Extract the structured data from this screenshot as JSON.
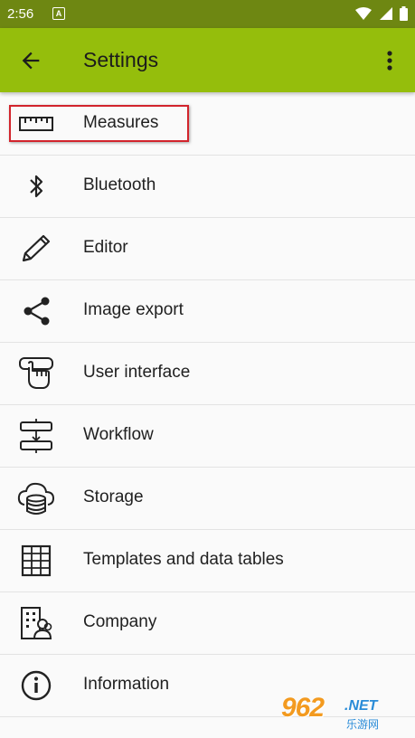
{
  "status_bar": {
    "time": "2:56",
    "notification_icon": "A"
  },
  "app_bar": {
    "title": "Settings",
    "back_icon": "arrow-back-icon",
    "menu_icon": "more-vert-icon"
  },
  "items": [
    {
      "label": "Measures",
      "icon": "ruler-icon"
    },
    {
      "label": "Bluetooth",
      "icon": "bluetooth-icon"
    },
    {
      "label": "Editor",
      "icon": "pencil-icon"
    },
    {
      "label": "Image export",
      "icon": "share-icon"
    },
    {
      "label": "User interface",
      "icon": "touch-hand-icon"
    },
    {
      "label": "Workflow",
      "icon": "workflow-icon"
    },
    {
      "label": "Storage",
      "icon": "cloud-database-icon"
    },
    {
      "label": "Templates and data tables",
      "icon": "table-grid-icon"
    },
    {
      "label": "Company",
      "icon": "company-icon"
    },
    {
      "label": "Information",
      "icon": "info-icon"
    }
  ],
  "watermark": {
    "brand": "962",
    "suffix": ".NET",
    "sub": "乐游网"
  },
  "colors": {
    "status_bar": "#6e8712",
    "app_bar": "#95be0c",
    "highlight": "#d2242c"
  }
}
